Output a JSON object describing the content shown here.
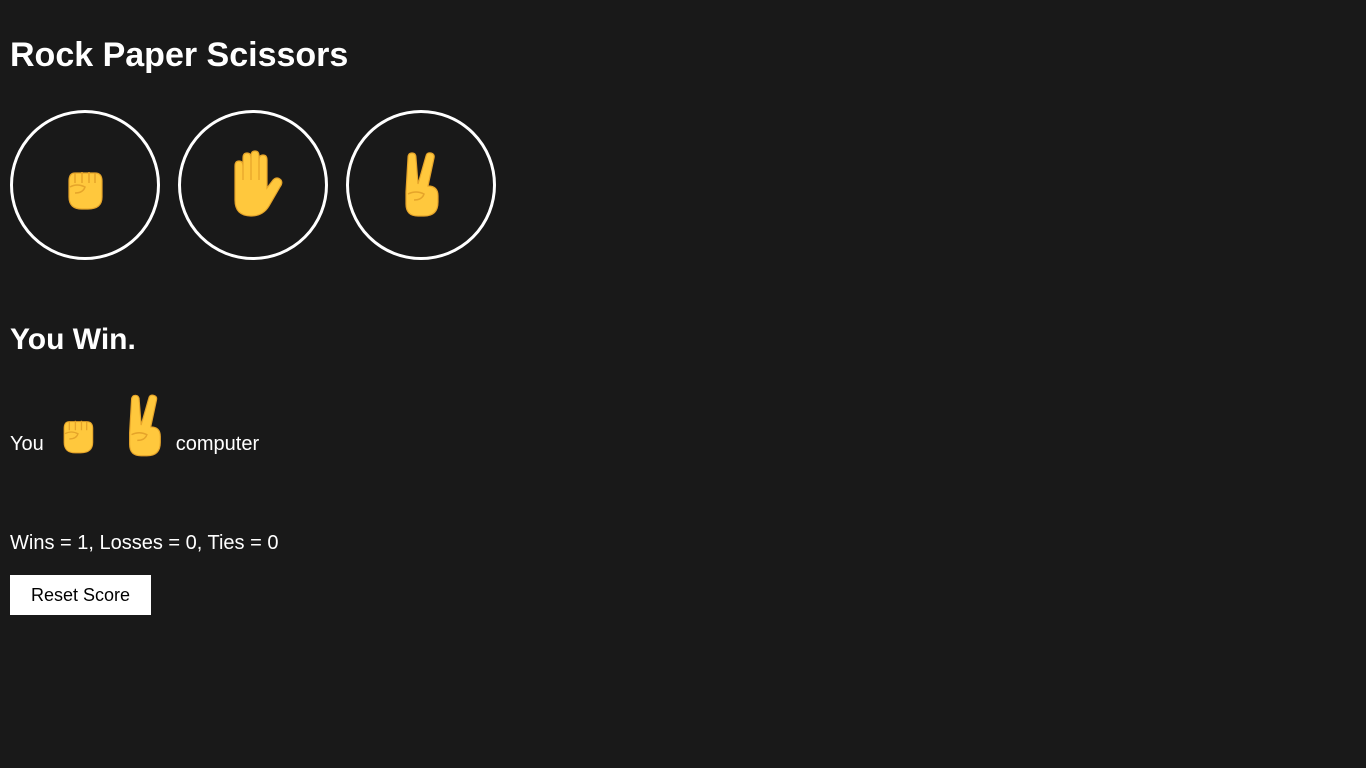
{
  "page": {
    "title": "Rock Paper Scissors",
    "background_color": "#191919",
    "text_color": "#ffffff"
  },
  "moves": [
    {
      "name": "rock",
      "icon": "raised-fist-icon"
    },
    {
      "name": "paper",
      "icon": "raised-hand-icon"
    },
    {
      "name": "scissors",
      "icon": "victory-hand-icon"
    }
  ],
  "result": {
    "text": "You Win.",
    "player_label": "You",
    "player_pick_icon": "raised-fist-icon",
    "computer_pick_icon": "victory-hand-icon",
    "computer_label": "computer"
  },
  "score": {
    "text": "Wins = 1, Losses = 0, Ties = 0"
  },
  "reset": {
    "label": "Reset Score"
  },
  "colors": {
    "hand_fill": "#FFC83D",
    "hand_shade": "#E5A42A"
  }
}
